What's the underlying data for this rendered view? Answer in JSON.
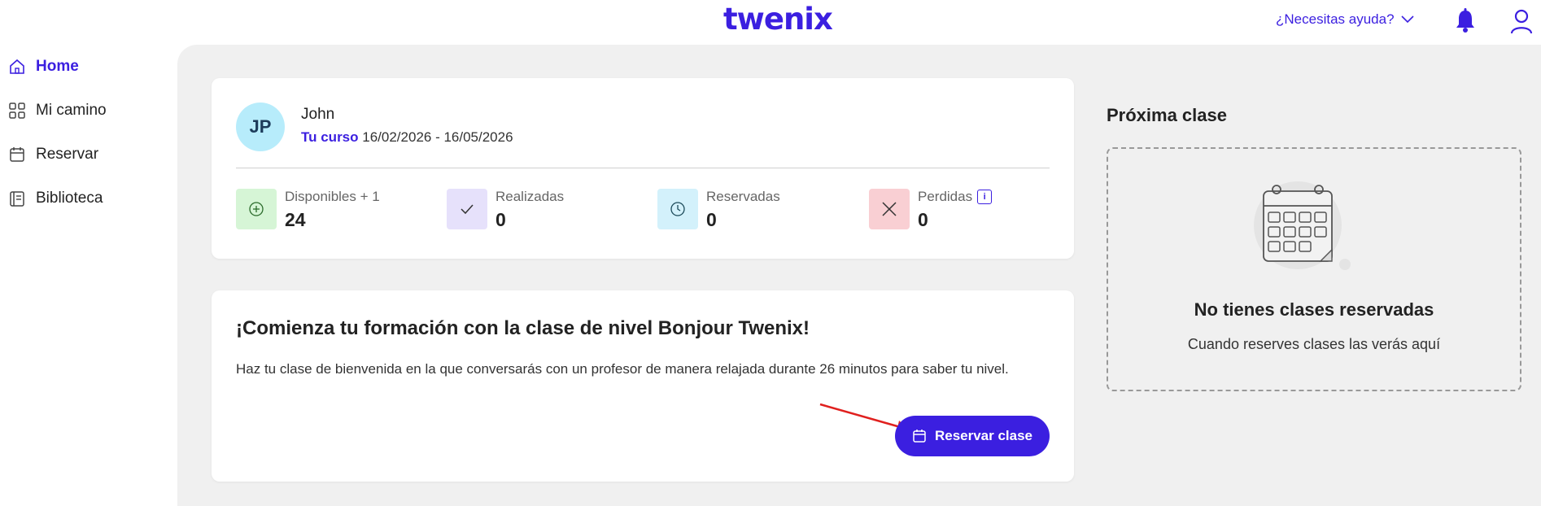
{
  "header": {
    "logo": "twenix",
    "help_label": "¿Necesitas ayuda?",
    "brand_color": "#3b1fe0"
  },
  "sidebar": {
    "items": [
      {
        "label": "Home",
        "icon": "home-icon",
        "active": true
      },
      {
        "label": "Mi camino",
        "icon": "grid-icon",
        "active": false
      },
      {
        "label": "Reservar",
        "icon": "calendar-icon",
        "active": false
      },
      {
        "label": "Biblioteca",
        "icon": "book-icon",
        "active": false
      }
    ]
  },
  "profile": {
    "initials": "JP",
    "name": "John",
    "course_label": "Tu curso",
    "course_dates": "16/02/2026 - 16/05/2026"
  },
  "stats": [
    {
      "label": "Disponibles + 1",
      "value": "24",
      "icon": "plus-circle-icon",
      "color": "#d6f5d6"
    },
    {
      "label": "Realizadas",
      "value": "0",
      "icon": "check-icon",
      "color": "#e6e1fb"
    },
    {
      "label": "Reservadas",
      "value": "0",
      "icon": "clock-icon",
      "color": "#d3f1fb"
    },
    {
      "label": "Perdidas",
      "value": "0",
      "icon": "x-icon",
      "color": "#f9cfd3"
    }
  ],
  "welcome": {
    "title": "¡Comienza tu formación con la clase de nivel Bonjour Twenix!",
    "text": "Haz tu clase de bienvenida en la que conversarás con un profesor de manera relajada durante 26 minutos para saber tu nivel.",
    "button_label": "Reservar clase"
  },
  "next_class": {
    "title": "Próxima clase",
    "empty_title": "No tienes clases reservadas",
    "empty_subtitle": "Cuando reserves clases las verás aquí"
  }
}
